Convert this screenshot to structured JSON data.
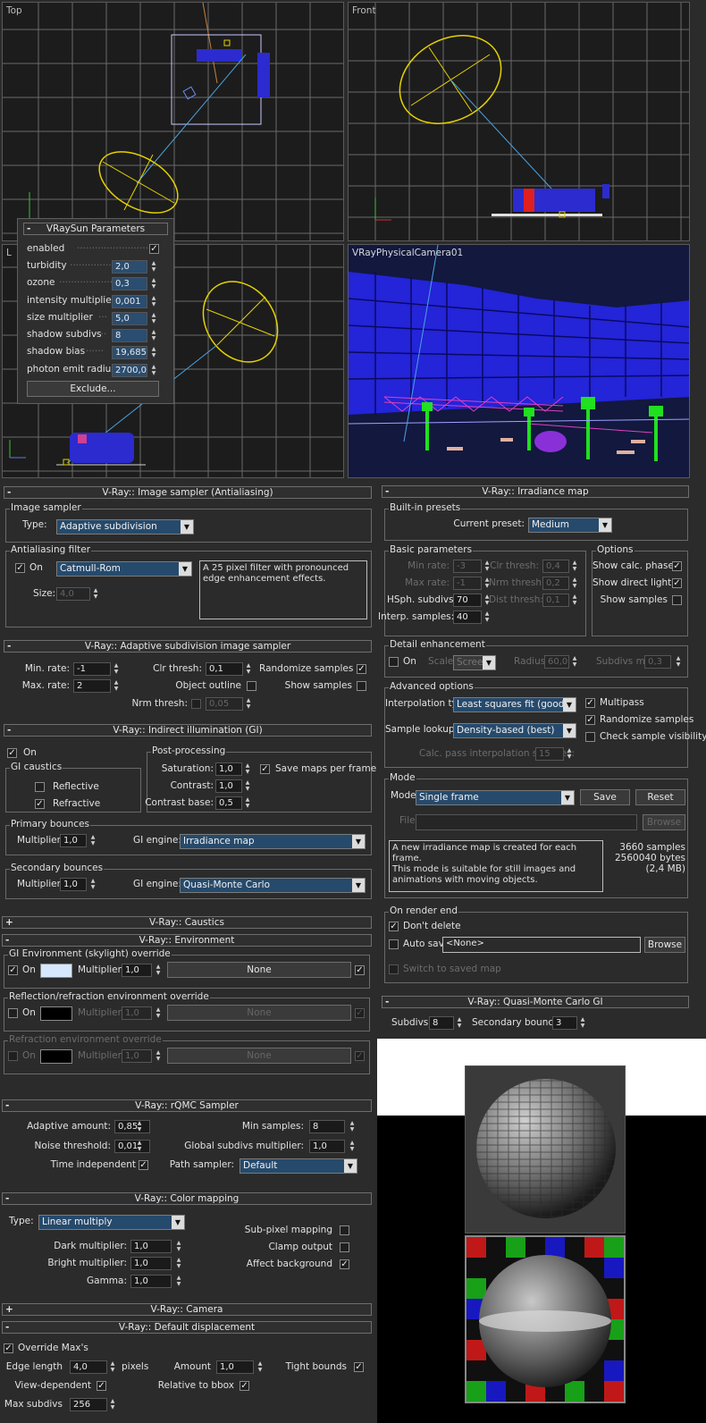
{
  "viewports": {
    "top_label": "Top",
    "front_label": "Front",
    "left_label": "L",
    "camera_label": "VRayPhysicalCamera01"
  },
  "sun": {
    "title": "VRaySun Parameters",
    "rows": [
      {
        "label": "enabled",
        "value": "✓"
      },
      {
        "label": "turbidity",
        "value": "2,0"
      },
      {
        "label": "ozone",
        "value": "0,3"
      },
      {
        "label": "intensity multiplier",
        "value": "0,001"
      },
      {
        "label": "size multiplier",
        "value": "5,0"
      },
      {
        "label": "shadow subdivs",
        "value": "8"
      },
      {
        "label": "shadow bias",
        "value": "19,685"
      },
      {
        "label": "photon emit radius",
        "value": "2700,0"
      }
    ],
    "exclude": "Exclude..."
  },
  "image_sampler": {
    "header": "V-Ray:: Image sampler (Antialiasing)",
    "group": "Image sampler",
    "type_label": "Type:",
    "type_value": "Adaptive subdivision",
    "aa_group": "Antialiasing filter",
    "on_label": "On",
    "filter": "Catmull-Rom",
    "desc": "A 25 pixel filter with pronounced edge enhancement effects.",
    "size_label": "Size:",
    "size_value": "4,0"
  },
  "adaptive": {
    "header": "V-Ray:: Adaptive subdivision image sampler",
    "min_label": "Min. rate:",
    "min_value": "-1",
    "max_label": "Max. rate:",
    "max_value": "2",
    "clr_label": "Clr thresh:",
    "clr_value": "0,1",
    "outline_label": "Object outline",
    "nrm_label": "Nrm thresh:",
    "nrm_value": "0,05",
    "randomize_label": "Randomize samples",
    "show_label": "Show samples"
  },
  "gi": {
    "header": "V-Ray:: Indirect illumination (GI)",
    "on_label": "On",
    "caustics_group": "GI caustics",
    "reflective": "Reflective",
    "refractive": "Refractive",
    "post_group": "Post-processing",
    "saturation_label": "Saturation:",
    "saturation": "1,0",
    "contrast_label": "Contrast:",
    "contrast": "1,0",
    "contrast_base_label": "Contrast base:",
    "contrast_base": "0,5",
    "save_maps": "Save maps per frame",
    "primary_group": "Primary bounces",
    "multiplier_label": "Multiplier:",
    "primary_mult": "1,0",
    "engine_label": "GI engine:",
    "primary_engine": "Irradiance map",
    "secondary_group": "Secondary bounces",
    "secondary_mult": "1,0",
    "secondary_engine": "Quasi-Monte Carlo"
  },
  "caustics": {
    "header": "V-Ray:: Caustics"
  },
  "environment": {
    "header": "V-Ray:: Environment",
    "gi_group": "GI Environment (skylight) override",
    "on_label": "On",
    "multiplier_label": "Multiplier:",
    "gi_mult": "1,0",
    "gi_map": "None",
    "refl_group": "Reflection/refraction environment override",
    "refl_mult": "1,0",
    "refl_map": "None",
    "refr_group": "Refraction environment override",
    "refr_mult": "1,0",
    "refr_map": "None",
    "gi_color": "#d6e8ff"
  },
  "rqmc": {
    "header": "V-Ray:: rQMC Sampler",
    "adaptive_label": "Adaptive amount:",
    "adaptive": "0,85",
    "noise_label": "Noise threshold:",
    "noise": "0,01",
    "time_label": "Time independent",
    "min_samples_label": "Min samples:",
    "min_samples": "8",
    "global_label": "Global subdivs multiplier:",
    "global": "1,0",
    "path_label": "Path sampler:",
    "path": "Default"
  },
  "color_mapping": {
    "header": "V-Ray:: Color mapping",
    "type_label": "Type:",
    "type": "Linear multiply",
    "dark_label": "Dark multiplier:",
    "dark": "1,0",
    "bright_label": "Bright multiplier:",
    "bright": "1,0",
    "gamma_label": "Gamma:",
    "gamma": "1,0",
    "subpixel": "Sub-pixel mapping",
    "clamp": "Clamp output",
    "affect": "Affect background"
  },
  "camera": {
    "header": "V-Ray:: Camera"
  },
  "displacement": {
    "header": "V-Ray:: Default displacement",
    "override": "Override Max's",
    "edge_label": "Edge length",
    "edge": "4,0",
    "pixels": "pixels",
    "amount_label": "Amount",
    "amount": "1,0",
    "tight": "Tight bounds",
    "view_dep": "View-dependent",
    "relative": "Relative to bbox",
    "max_subdivs_label": "Max subdivs",
    "max_subdivs": "256"
  },
  "irradiance": {
    "header": "V-Ray:: Irradiance map",
    "presets_group": "Built-in presets",
    "preset_label": "Current preset:",
    "preset": "Medium",
    "basic_group": "Basic parameters",
    "min_rate_label": "Min rate:",
    "min_rate": "-3",
    "max_rate_label": "Max rate:",
    "max_rate": "-1",
    "hsph_label": "HSph. subdivs:",
    "hsph": "70",
    "interp_label": "Interp. samples:",
    "interp": "40",
    "clr_label": "Clr thresh:",
    "clr": "0,4",
    "nrm_label": "Nrm thresh:",
    "nrm": "0,2",
    "dist_label": "Dist thresh:",
    "dist": "0,1",
    "options_group": "Options",
    "show_calc": "Show calc. phase",
    "show_direct": "Show direct light",
    "show_samples": "Show samples",
    "detail_group": "Detail enhancement",
    "on_label": "On",
    "scale_label": "Scale:",
    "scale": "Screen",
    "radius_label": "Radius:",
    "radius": "60,0",
    "subdivs_mult_label": "Subdivs mult.",
    "subdivs_mult": "0,3",
    "advanced_group": "Advanced options",
    "interp_type_label": "Interpolation type:",
    "interp_type": "Least squares fit (good/smooth",
    "lookup_label": "Sample lookup:",
    "lookup": "Density-based (best)",
    "calc_pass_label": "Calc. pass interpolation samples:",
    "calc_pass": "15",
    "multipass": "Multipass",
    "randomize": "Randomize samples",
    "check_vis": "Check sample visibility",
    "mode_group": "Mode",
    "mode_label": "Mode:",
    "mode": "Single frame",
    "save": "Save",
    "reset": "Reset",
    "file_label": "File:",
    "browse": "Browse",
    "mode_desc": "A new irradiance map is created for each frame.\nThis mode is suitable for still images and animations with moving objects.",
    "samples": "3660 samples",
    "bytes": "2560040 bytes (2,4 MB)",
    "render_end_group": "On render end",
    "dont_delete": "Don't delete",
    "auto_save": "Auto save:",
    "auto_save_path": "<None>",
    "browse2": "Browse",
    "switch": "Switch to saved map"
  },
  "qmc_gi": {
    "header": "V-Ray:: Quasi-Monte Carlo GI",
    "subdivs_label": "Subdivs:",
    "subdivs": "8",
    "bounces_label": "Secondary bounces:",
    "bounces": "3"
  }
}
